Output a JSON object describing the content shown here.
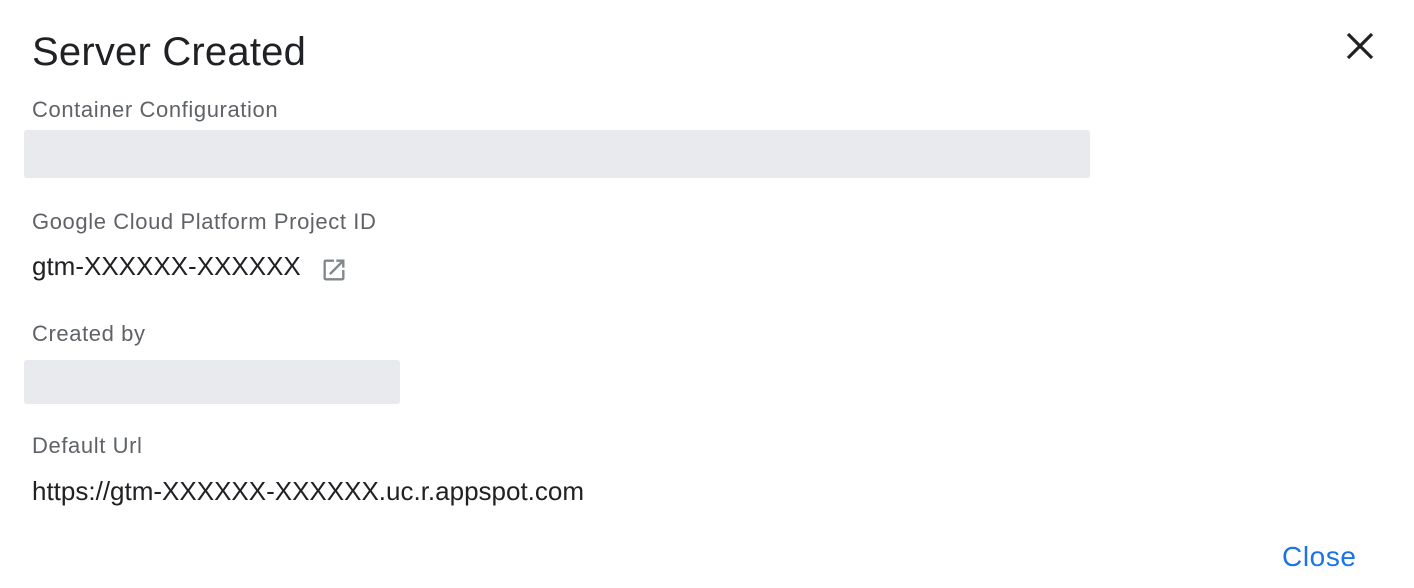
{
  "dialog": {
    "title": "Server Created",
    "close_icon": "close-icon"
  },
  "fields": {
    "container_configuration": {
      "label": "Container Configuration"
    },
    "gcp_project_id": {
      "label": "Google Cloud Platform Project ID",
      "value": "gtm-XXXXXX-XXXXXX",
      "link_icon": "open-in-new-icon"
    },
    "created_by": {
      "label": "Created by"
    },
    "default_url": {
      "label": "Default Url",
      "value": "https://gtm-XXXXXX-XXXXXX.uc.r.appspot.com"
    }
  },
  "actions": {
    "close_label": "Close"
  },
  "colors": {
    "title_text": "#202124",
    "label_text": "#5f6368",
    "placeholder_bg": "#e8eaed",
    "accent": "#1a73e8",
    "icon": "#5f6368"
  }
}
